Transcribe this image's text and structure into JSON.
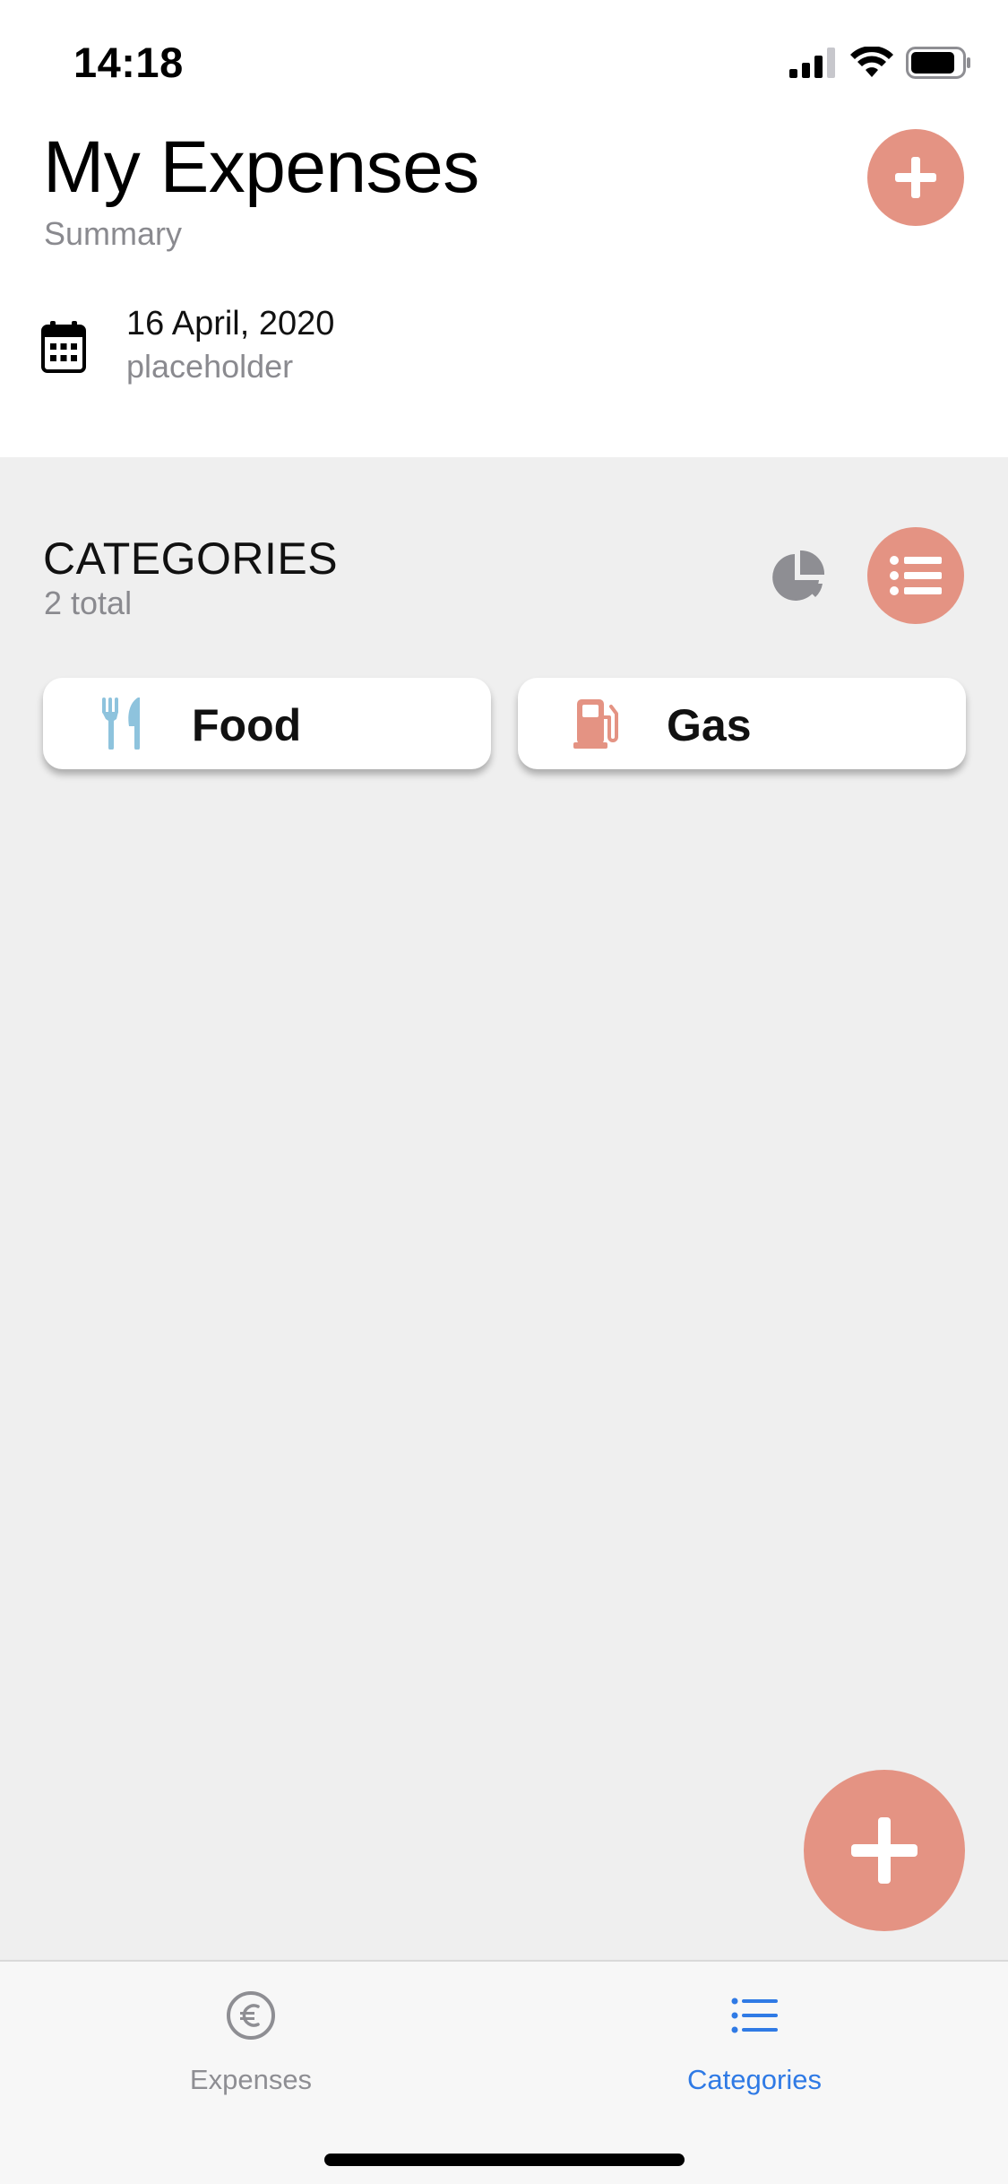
{
  "status_bar": {
    "time": "14:18",
    "icons": [
      "signal-icon",
      "wifi-icon",
      "battery-icon"
    ]
  },
  "header": {
    "title": "My Expenses",
    "subtitle": "Summary",
    "add_button_icon": "plus-icon",
    "date": {
      "icon": "calendar-icon",
      "value": "16 April, 2020",
      "sub": "placeholder"
    }
  },
  "categories_section": {
    "title": "CATEGORIES",
    "count": "2 total",
    "pie_toggle_icon": "pie-chart-icon",
    "list_toggle_icon": "list-icon",
    "items": [
      {
        "label": "Food",
        "icon": "fork-knife-icon",
        "color": "#8ec3dd"
      },
      {
        "label": "Gas",
        "icon": "gas-pump-icon",
        "color": "#e49383"
      }
    ]
  },
  "fab": {
    "icon": "plus-icon"
  },
  "tab_bar": {
    "tabs": [
      {
        "label": "Expenses",
        "icon": "euro-icon",
        "active": false
      },
      {
        "label": "Categories",
        "icon": "list-icon",
        "active": true
      }
    ]
  },
  "colors": {
    "accent": "#e49383",
    "food": "#8ec3dd",
    "active_tab": "#2f7ae5",
    "inactive_tab": "#8e8e93",
    "content_bg": "#efefef"
  }
}
